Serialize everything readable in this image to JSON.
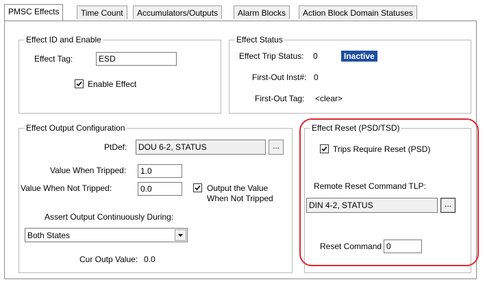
{
  "tabs": [
    {
      "label": "PMSC Effects"
    },
    {
      "label": "Time Count"
    },
    {
      "label": "Accumulators/Outputs"
    },
    {
      "label": "Alarm Blocks"
    },
    {
      "label": "Action Block Domain Statuses"
    }
  ],
  "effect_id": {
    "title": "Effect ID and Enable",
    "tag_label": "Effect Tag:",
    "tag_value": "ESD",
    "enable_label": "Enable Effect",
    "enable_checked": true
  },
  "effect_status": {
    "title": "Effect Status",
    "trip_status_label": "Effect Trip Status:",
    "trip_status_value": "0",
    "state_badge": "Inactive",
    "first_out_inst_label": "First-Out Inst#:",
    "first_out_inst_value": "0",
    "first_out_tag_label": "First-Out Tag:",
    "first_out_tag_value": "<clear>"
  },
  "output_config": {
    "title": "Effect Output Configuration",
    "ptdef_label": "PtDef:",
    "ptdef_value": "DOU 6-2, STATUS",
    "ptdef_button": "...",
    "value_tripped_label": "Value When Tripped:",
    "value_tripped": "1.0",
    "value_not_tripped_label": "Value When Not Tripped:",
    "value_not_tripped": "0.0",
    "output_not_tripped_label_1": "Output the Value",
    "output_not_tripped_label_2": "When Not Tripped",
    "output_not_tripped_checked": true,
    "assert_label": "Assert Output Continuously During:",
    "assert_selected": "Both States",
    "cur_outp_label": "Cur Outp Value:",
    "cur_outp_value": "0.0"
  },
  "effect_reset": {
    "title": "Effect Reset (PSD/TSD)",
    "trips_require_reset_label": "Trips Require Reset (PSD)",
    "trips_require_reset_checked": true,
    "remote_reset_label": "Remote Reset Command TLP:",
    "remote_reset_value": "DIN 4-2, STATUS",
    "remote_reset_button": "...",
    "reset_command_label": "Reset Command :",
    "reset_command_value": "0"
  },
  "colors": {
    "highlight": "#e0272e",
    "badge_bg": "#1f4fa0"
  }
}
